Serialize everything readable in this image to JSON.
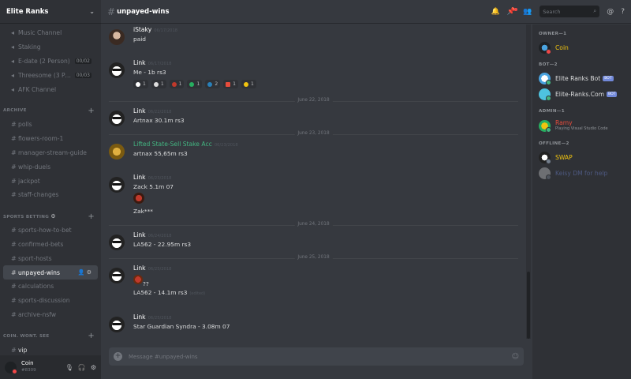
{
  "guild": {
    "name": "Elite Ranks"
  },
  "sidebar": {
    "top_channels": [
      {
        "label": "Music Channel",
        "type": "voice",
        "count": ""
      },
      {
        "label": "Staking",
        "type": "voice",
        "count": ""
      },
      {
        "label": "E-date (2 Person)",
        "type": "voice",
        "count": "00/02"
      },
      {
        "label": "Threesome (3 Perso...",
        "type": "voice",
        "count": "00/03"
      },
      {
        "label": "AFK Channel",
        "type": "voice",
        "count": ""
      }
    ],
    "archive": {
      "title": "ARCHIVE",
      "channels": [
        "polls",
        "flowers-room-1",
        "manager-stream-guide",
        "whip-duels",
        "jackpot",
        "staff-changes"
      ]
    },
    "sports": {
      "title": "SPORTS BETTING",
      "channels": [
        "sports-how-to-bet",
        "confirmed-bets",
        "sport-hosts",
        "unpayed-wins",
        "calculations",
        "sports-discussion",
        "archive-nsfw"
      ]
    },
    "coin": {
      "title": "COIN. WONT. SEE",
      "channels": [
        "vip"
      ]
    }
  },
  "user_panel": {
    "name": "Coin",
    "tag": "#8309"
  },
  "topbar": {
    "channel": "unpayed-wins",
    "search_placeholder": "Search"
  },
  "messages": [
    {
      "author": "iStaky",
      "time": "06/17/2018",
      "lines": [
        "paid"
      ]
    },
    {
      "author": "Link",
      "time": "06/17/2018",
      "lines": [
        "Me - 1b rs3"
      ],
      "reactions": [
        "1",
        "1",
        "1",
        "1",
        "2",
        "1",
        "1"
      ]
    },
    {
      "divider": "June 22, 2018"
    },
    {
      "author": "Link",
      "time": "06/22/2018",
      "lines": [
        "Artnax 30.1m rs3"
      ]
    },
    {
      "divider": "June 23, 2018"
    },
    {
      "author": "Lifted State-Sell Stake Acc",
      "time": "06/23/2018",
      "lines": [
        "artnax 55,65m rs3"
      ]
    },
    {
      "author": "Link",
      "time": "06/23/2018",
      "lines": [
        "Zack 5.1m 07",
        "Zak***"
      ]
    },
    {
      "divider": "June 24, 2018"
    },
    {
      "author": "Link",
      "time": "06/24/2018",
      "lines": [
        "LA562 - 22.95m rs3"
      ]
    },
    {
      "divider": "June 25, 2018"
    },
    {
      "author": "Link",
      "time": "06/25/2018",
      "lines": [
        "??",
        "LA562 - 14.1m rs3"
      ],
      "edited": "(edited)"
    },
    {
      "author": "Link",
      "time": "06/25/2018",
      "lines": [
        "Star Guardian Syndra - 3.08m 07"
      ]
    }
  ],
  "composer": {
    "placeholder": "Message #unpayed-wins"
  },
  "members": {
    "owner": {
      "title": "OWNER—1",
      "list": [
        {
          "name": "Coin",
          "color": "#f1c40f"
        }
      ]
    },
    "bot": {
      "title": "BOT—2",
      "list": [
        {
          "name": "Elite Ranks Bot",
          "badge": "BOT"
        },
        {
          "name": "Elite-Ranks.Com",
          "badge": "BOT"
        }
      ]
    },
    "admin": {
      "title": "ADMIN—1",
      "list": [
        {
          "name": "Ramy",
          "color": "#e74c3c",
          "status": "Playing Visual Studio Code"
        }
      ]
    },
    "offline": {
      "title": "OFFLINE—2",
      "list": [
        {
          "name": "SWAP",
          "color": "#f1c40f"
        },
        {
          "name": "Keisy DM for help",
          "color": "#7289da"
        }
      ]
    }
  },
  "colors": {
    "lifted_state": "#43b581",
    "owner": "#f1c40f",
    "admin": "#e74c3c"
  }
}
